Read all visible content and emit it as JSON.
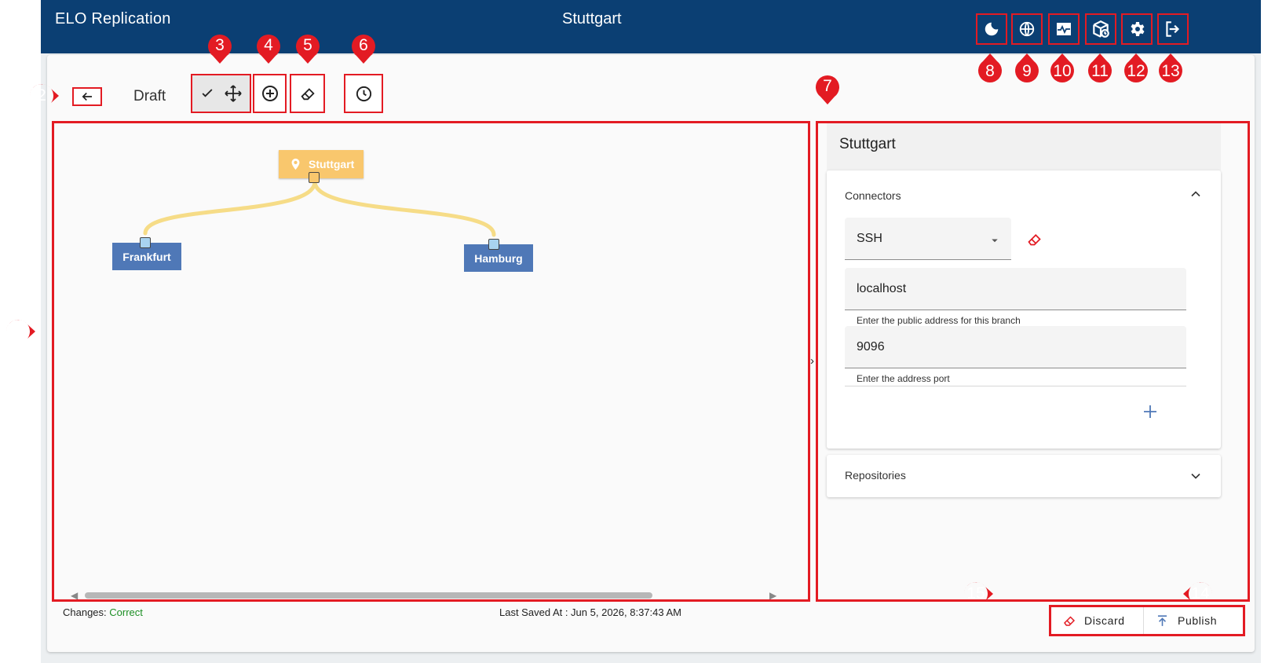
{
  "app": {
    "title": "ELO Replication",
    "active_branch": "Stuttgart"
  },
  "toolbar": {
    "status": "Draft"
  },
  "graph": {
    "root": {
      "label": "Stuttgart",
      "color": "#f9c76d"
    },
    "children": [
      {
        "label": "Frankfurt",
        "color": "#4f78b7"
      },
      {
        "label": "Hamburg",
        "color": "#4f78b7"
      }
    ],
    "connection_color": "#f6dc87"
  },
  "details": {
    "title": "Stuttgart",
    "connectors": {
      "title": "Connectors",
      "protocol": "SSH",
      "address_value": "localhost",
      "address_hint": "Enter the public address for this branch",
      "port_value": "9096",
      "port_hint": "Enter the address port"
    },
    "repositories": {
      "title": "Repositories"
    }
  },
  "footer": {
    "changes_label": "Changes:",
    "changes_value": "Correct",
    "saved_label": "Last Saved At : Jun 5, 2026, 8:37:43 AM",
    "discard_label": "Discard",
    "publish_label": "Publish"
  },
  "annotations": [
    "1",
    "2",
    "3",
    "4",
    "5",
    "6",
    "7",
    "8",
    "9",
    "10",
    "11",
    "12",
    "13",
    "14",
    "15"
  ],
  "colors": {
    "accent": "#e31b23",
    "topbar": "#0b3f73",
    "success": "#1d8f25",
    "primary": "#4f78b7"
  }
}
